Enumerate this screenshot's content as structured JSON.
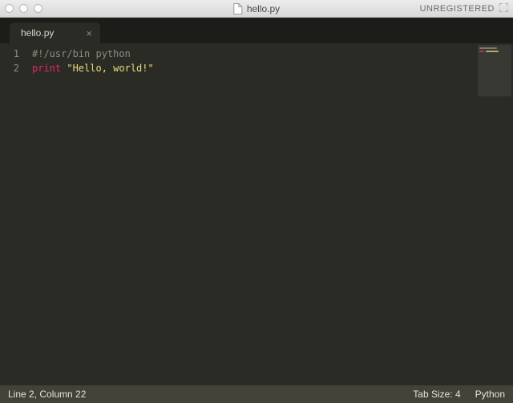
{
  "titlebar": {
    "filename": "hello.py",
    "registration": "UNREGISTERED"
  },
  "tab": {
    "label": "hello.py",
    "close_glyph": "×"
  },
  "gutter": {
    "line1": "1",
    "line2": "2"
  },
  "code": {
    "line1_comment": "#!/usr/bin python",
    "line2_keyword": "print",
    "line2_space": " ",
    "line2_string": "\"Hello, world!\""
  },
  "status": {
    "position": "Line 2, Column 22",
    "tabsize": "Tab Size: 4",
    "language": "Python"
  }
}
